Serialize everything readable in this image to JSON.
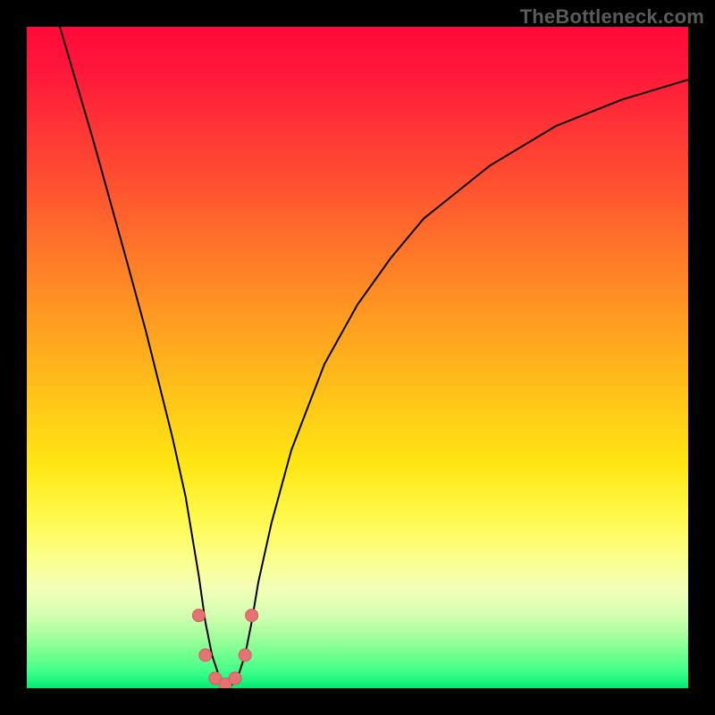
{
  "watermark": "TheBottleneck.com",
  "colors": {
    "curve_stroke": "#000000",
    "marker_fill": "#e57373",
    "marker_stroke": "#d15c5c",
    "background_black": "#000000"
  },
  "chart_data": {
    "type": "line",
    "title": "",
    "xlabel": "",
    "ylabel": "",
    "xlim": [
      0,
      100
    ],
    "ylim": [
      0,
      100
    ],
    "grid": false,
    "legend": false,
    "notes": "Background is a vertical gradient from red (top, high bottleneck) to green (bottom, low bottleneck). Curve plots bottleneck percentage vs an implied x-axis; the dip near x≈27–33 is the optimal match (≈0% bottleneck). Values estimated from pixel positions; no axis ticks or labels rendered in image.",
    "series": [
      {
        "name": "bottleneck_percent",
        "x": [
          5,
          10,
          15,
          18,
          20,
          22,
          24,
          26,
          27,
          28,
          29,
          30,
          31,
          32,
          33,
          34,
          35,
          37,
          40,
          45,
          50,
          55,
          60,
          65,
          70,
          75,
          80,
          85,
          90,
          95,
          100
        ],
        "y": [
          100,
          83,
          65,
          54,
          46,
          38,
          29,
          17,
          10,
          5,
          2,
          0.5,
          0.5,
          2,
          5,
          10,
          16,
          25,
          36,
          49,
          58,
          65,
          71,
          75,
          79,
          82,
          85,
          87,
          89,
          90.5,
          92
        ]
      }
    ],
    "markers": {
      "name": "optimal_region",
      "x": [
        26,
        27,
        28.5,
        30,
        31.5,
        33,
        34
      ],
      "y": [
        11,
        5,
        1.5,
        0.6,
        1.5,
        5,
        11
      ],
      "radius_px": 7
    }
  }
}
